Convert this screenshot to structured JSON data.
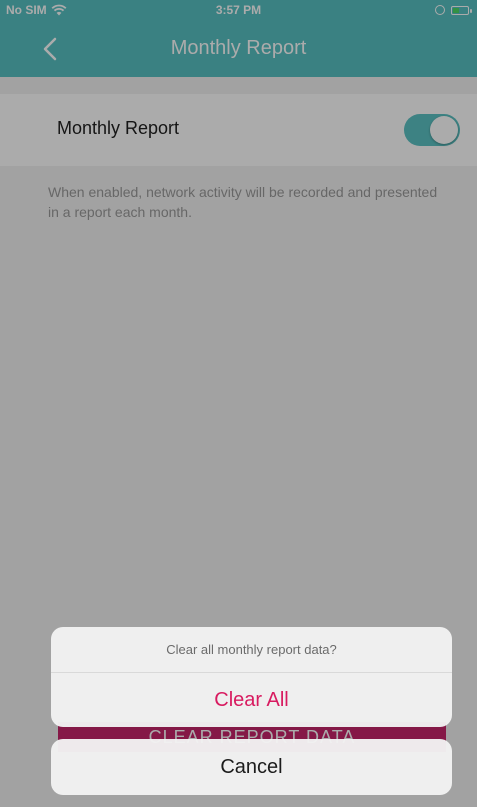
{
  "status_bar": {
    "carrier": "No SIM",
    "time": "3:57 PM",
    "icons": [
      "wifi-icon",
      "lock-icon",
      "battery-icon"
    ]
  },
  "nav": {
    "title": "Monthly Report",
    "back_icon": "chevron-left-icon"
  },
  "setting": {
    "label": "Monthly Report",
    "enabled": true,
    "description": "When enabled, network activity will be recorded and presented in a report each month."
  },
  "clear_button": {
    "label": "CLEAR REPORT DATA"
  },
  "action_sheet": {
    "message": "Clear all monthly report data?",
    "destructive_action": "Clear All",
    "cancel": "Cancel"
  },
  "colors": {
    "accent": "#57c1c2",
    "destructive": "#d81b60",
    "button": "#c6246a"
  }
}
